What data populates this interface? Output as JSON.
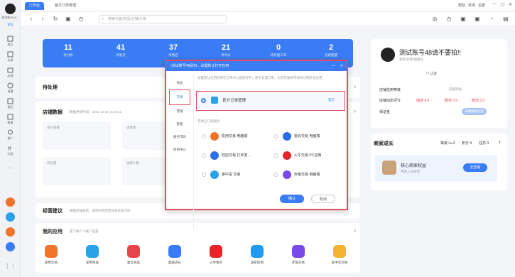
{
  "sidebar": {
    "avatar_label": "测试账号48…",
    "home": "首页",
    "items": [
      "商品",
      "交易",
      "店铺",
      "直播",
      "售后",
      "数据",
      "推广",
      "内容",
      "…"
    ]
  },
  "titlebar": {
    "tab_workbench": "工作台",
    "tab_orders": "官方订单管理",
    "right_links": [
      "帮助",
      "反馈",
      "设置"
    ],
    "window_buttons": [
      "—",
      "▢",
      "✕"
    ]
  },
  "nav": {
    "search_placeholder": "搜索功能/商品/店铺/头条"
  },
  "stats": [
    {
      "n": "11",
      "l": "待付款"
    },
    {
      "n": "41",
      "l": "待发货"
    },
    {
      "n": "37",
      "l": "待售后"
    },
    {
      "n": "21",
      "l": "待评价"
    },
    {
      "n": "0",
      "l": "待处理工单"
    },
    {
      "n": "2",
      "l": "违规提醒"
    }
  ],
  "todo_title": "待处理",
  "store_data": {
    "title": "店铺数据",
    "updated": "数据更新时间：2021-12-16 15:15:11",
    "cards": [
      "支付金额",
      "访客数",
      "浏览量",
      "加购人数"
    ]
  },
  "suggest": {
    "title": "经营建议",
    "note": "根据店铺表现，提供的经营建议和优化方向"
  },
  "myapps": {
    "title": "我的应用",
    "note": "置下载个人账户设置",
    "apps": [
      {
        "name": "爱用交易",
        "color": "#f0742c"
      },
      {
        "name": "爱用商品",
        "color": "#2ba2e8"
      },
      {
        "name": "雷云商品",
        "color": "#e8434b"
      },
      {
        "name": "超级店长",
        "color": "#3a7cf3"
      },
      {
        "name": "火牛管店",
        "color": "#e8242b"
      },
      {
        "name": "美折促销",
        "color": "#1f9af0"
      },
      {
        "name": "赤兔交易",
        "color": "#7a4ae8"
      },
      {
        "name": "掌中宝交易",
        "color": "#f3b430"
      }
    ]
  },
  "modal": {
    "header": "(测试账号48请勿…设置默认打开应用",
    "minimize": "—",
    "close": "✕",
    "nav": [
      "商品",
      "交易",
      "营销",
      "客服",
      "服务市场",
      "招商中心"
    ],
    "desc": "设置默认应用后将在订单中心直接打开，便于处理订单，也可在服务市场中订购更多应用",
    "selected_app": "官方订单管理",
    "selected_tag": "官方",
    "other_label": "其他已订购服务",
    "services": [
      {
        "name": "爱用交易 电脑端",
        "color": "#f0742c"
      },
      {
        "name": "雷云交易 电脑端",
        "color": "#2b6ee8"
      },
      {
        "name": "旺店交易 打单发…",
        "color": "#2b6ee8"
      },
      {
        "name": "火牛交易 PC应用",
        "color": "#e8242b"
      },
      {
        "name": "掌中宝 交易",
        "color": "#2ba2e8"
      },
      {
        "name": "赤兔交易 电脑端",
        "color": "#7a4ae8"
      }
    ],
    "ok": "确认",
    "cancel": "取消"
  },
  "right": {
    "account": "测试账号48请不要拍!!",
    "sub": "掌柜/卖家/旗舰店",
    "verify": "认证",
    "level_label": "店铺信用等级",
    "level_val": "店铺等级",
    "dsr_label": "店铺动态评分",
    "dsr": [
      "描述 4.6 ↑",
      "服务 5.0 ↑",
      "物流 5.0 ↑"
    ],
    "bond_label": "保证金",
    "bond_val": "未缴纳保证金",
    "growth_title": "商家成长",
    "growth_level": "等级 Lv.3",
    "growth_score": "积分 9",
    "growth_rank": "任务 9",
    "growth_card_title": "核心商家权益",
    "growth_card_sub": "申请入驻获得",
    "growth_btn": "去查看"
  }
}
